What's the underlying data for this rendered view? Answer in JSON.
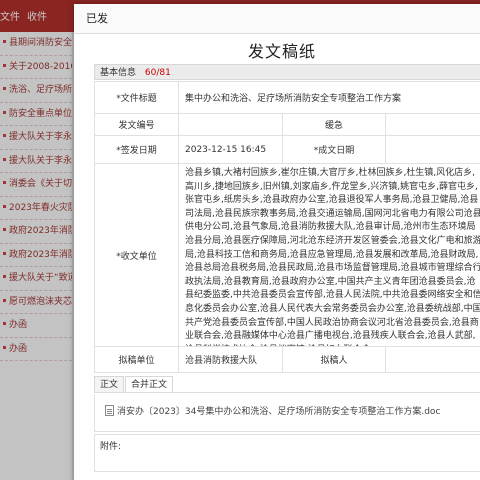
{
  "background": {
    "tabs": [
      "文件",
      "收件"
    ],
    "list_items": [
      "县期间消防安全工",
      "关于2008-2016年度",
      "洗浴、足疗场所消",
      "防安全重点单位统",
      "援大队关于李永新",
      "援大队关于李永新",
      "消委会《关于切实",
      "2023年春火灾防控",
      "政府2023年消防工",
      "政府2023年消防工",
      "援大队关于“致道",
      "愿可燃泡沫夹芯彩",
      "办函",
      "办函"
    ]
  },
  "dialog": {
    "title": "已发",
    "doc_title": "发文稿纸",
    "section": {
      "label": "基本信息",
      "count": "60/81"
    },
    "fields": {
      "doc_title_label": "*文件标题",
      "doc_title_value": "集中办公和洗浴、足疗场所消防安全专项整治工作方案",
      "doc_no_label": "发文编号",
      "doc_no_value": "",
      "secret_label": "缓急",
      "sign_date_label": "*签发日期",
      "sign_date_value": "2023-12-15 16:45",
      "final_date_label": "*成文日期",
      "recv_label": "*收文单位",
      "recv_value": "沧县乡镇,大褚村回族乡,崔尔庄镇,大官厅乡,杜林回族乡,杜生镇,风化店乡,高川乡,捷地回族乡,旧州镇,刘家庙乡,仵龙堂乡,兴济镇,姚官屯乡,薛官屯乡,张官屯乡,纸房头乡,沧县政府办公室,沧县退役军人事务局,沧县卫健局,沧县司法局,沧县民族宗教事务局,沧县交通运输局,国网河北省电力有限公司沧县供电分公司,沧县气象局,沧县消防救援大队,沧县审计局,沧州市生态环境局沧县分局,沧县医疗保障局,河北沧东经济开发区管委会,沧县文化广电和旅游局,沧县科技工信和商务局,沧县应急管理局,沧县发展和改革局,沧县财政局,沧县总局沧县税务局,沧县民政局,沧县市场监督管理局,沧县城市管理综合行政执法局,沧县教育局,沧县政府办公室,中国共产主义青年团沧县委员会,沧县纪委监委,中共沧县委员会宣传部,沧县人民法院,中共沧县委网络安全和信息化委员会办公室,沧县人民代表大会常务委员会办公室,沧县委统战部,中国共产党沧县委员会宣传部,中国人民政治协商会议河北省沧县委员会,沧县商业联合会,沧县融媒体中心沧县广播电视台,沧县残疾人联合会,沧县人武部,沧县科学技术协会,沧县档案馆,沧县妇女联合会",
      "drafter_unit_label": "拟稿单位",
      "drafter_unit_value": "沧县消防救援大队",
      "drafter_label": "拟稿人"
    },
    "tabs": [
      "正文",
      "合并正文"
    ],
    "attachment_file": "消安办〔2023〕34号集中办公和洗浴、足疗场所消防安全专项整治工作方案.doc",
    "attachments_label": "附件:"
  }
}
